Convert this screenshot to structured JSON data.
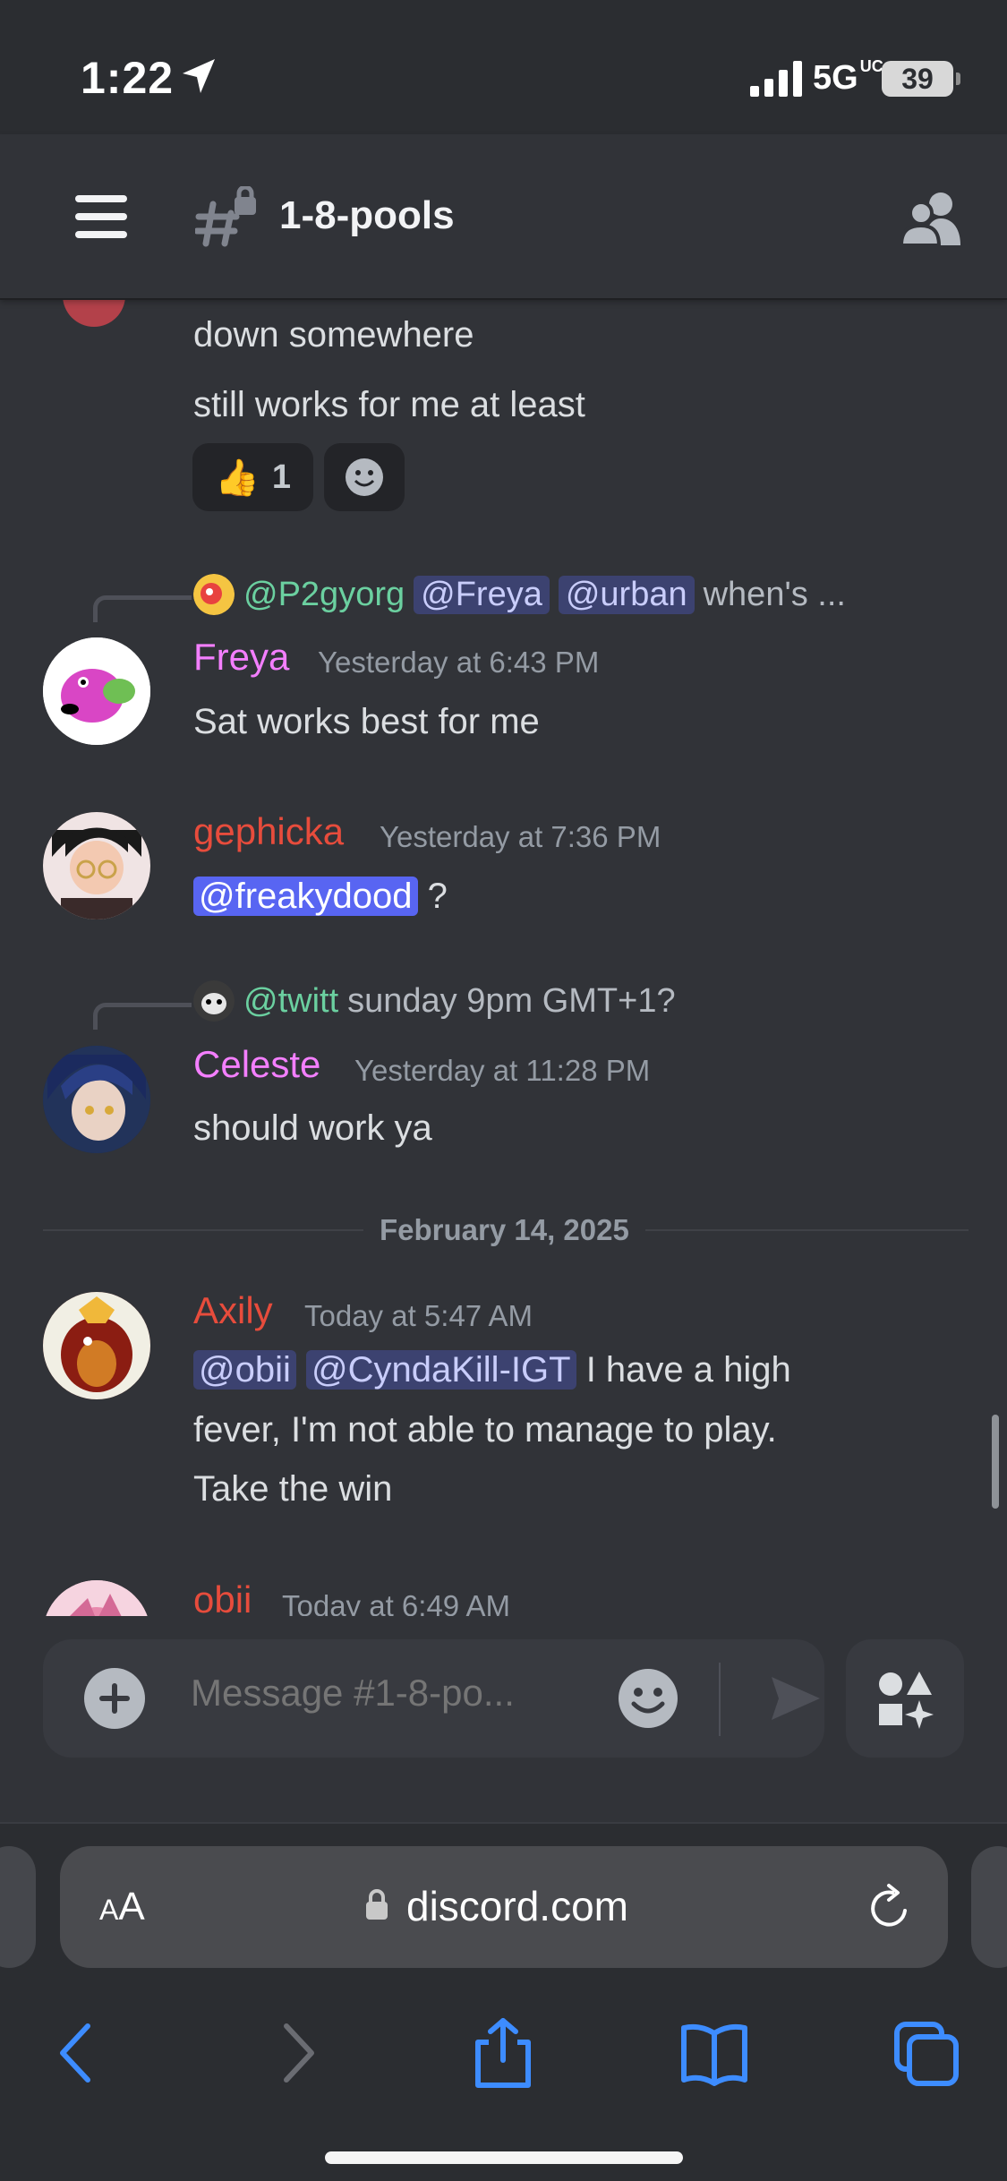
{
  "status_bar": {
    "time": "1:22",
    "network": "5G",
    "network_suffix": "UC",
    "battery": "39"
  },
  "header": {
    "channel_name": "1-8-pools",
    "menu_icon": "hamburger-menu-icon",
    "channel_icon": "locked-hash-icon",
    "members_icon": "members-icon"
  },
  "messages": {
    "prior": {
      "lines": [
        "down somewhere",
        "still works for me at least"
      ],
      "reactions": [
        {
          "emoji": "👍",
          "count": "1"
        }
      ],
      "add_reaction_icon": "add-reaction-icon"
    },
    "freya": {
      "reply": {
        "author": "@P2gyorg",
        "mentions": [
          "@Freya",
          "@urban"
        ],
        "text": "when's ..."
      },
      "author": "Freya",
      "author_color": "#f47fff",
      "timestamp": "Yesterday at 6:43 PM",
      "text": "Sat works best for me"
    },
    "gephicka": {
      "author": "gephicka",
      "author_color": "#e74c3c",
      "timestamp": "Yesterday at 7:36 PM",
      "mention": "@freakydood",
      "text": "?"
    },
    "celeste": {
      "reply": {
        "author": "@twitt",
        "text": "sunday 9pm GMT+1?"
      },
      "author": "Celeste",
      "author_color": "#f47fff",
      "timestamp": "Yesterday at 11:28 PM",
      "text": "should work ya"
    },
    "date_divider": "February 14, 2025",
    "axily": {
      "author": "Axily",
      "author_color": "#e74c3c",
      "timestamp": "Today at 5:47 AM",
      "mentions": [
        "@obii",
        "@CyndaKill-IGT"
      ],
      "text_line1": "I have a high",
      "text_line2": "fever, I'm not able to manage to play.",
      "text_line3": "Take the win"
    },
    "obii": {
      "author": "obii",
      "author_color": "#e74c3c",
      "timestamp": "Today at 6:49 AM"
    }
  },
  "composer": {
    "placeholder": "Message #1-8-po..."
  },
  "browser": {
    "text_size_label_small": "A",
    "text_size_label_large": "A",
    "url": "discord.com"
  }
}
